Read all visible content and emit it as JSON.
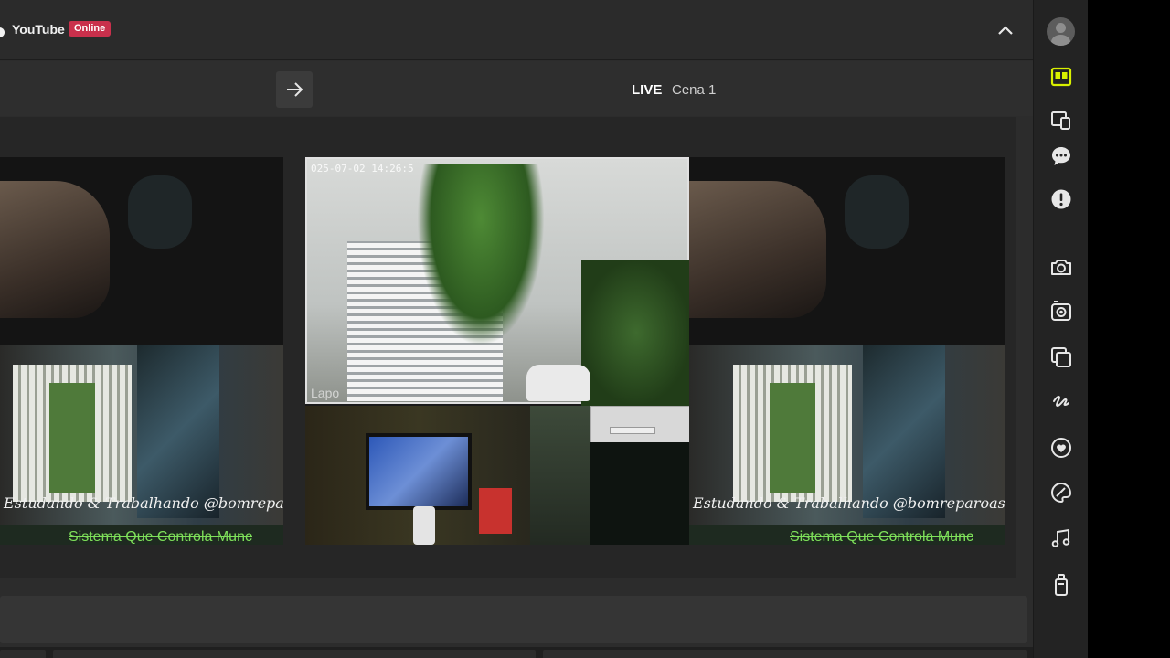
{
  "header": {
    "platform_name": "YouTube",
    "status_badge": "Online"
  },
  "toolbar": {
    "live_label": "LIVE",
    "scene_name": "Cena 1"
  },
  "preview": {
    "cctv_timestamp": "025-07-02 14:26:5",
    "cctv_brand": "Lapo",
    "overlay_text": "Estudando & Trabalhando @bomreparoassistenc",
    "ticker_text": "Sistema Que Controla Munc"
  },
  "sidebar": {
    "active_icon": "layout-icon",
    "icons": [
      "layout-icon",
      "devices-icon",
      "chat-icon",
      "alert-icon",
      "camera-icon",
      "camera-flip-icon",
      "copy-icon",
      "scribble-icon",
      "heart-icon",
      "palette-icon",
      "music-icon",
      "remote-icon"
    ]
  },
  "colors": {
    "accent": "#d8f000",
    "badge": "#c9304c",
    "ticker": "#7ee05a"
  }
}
